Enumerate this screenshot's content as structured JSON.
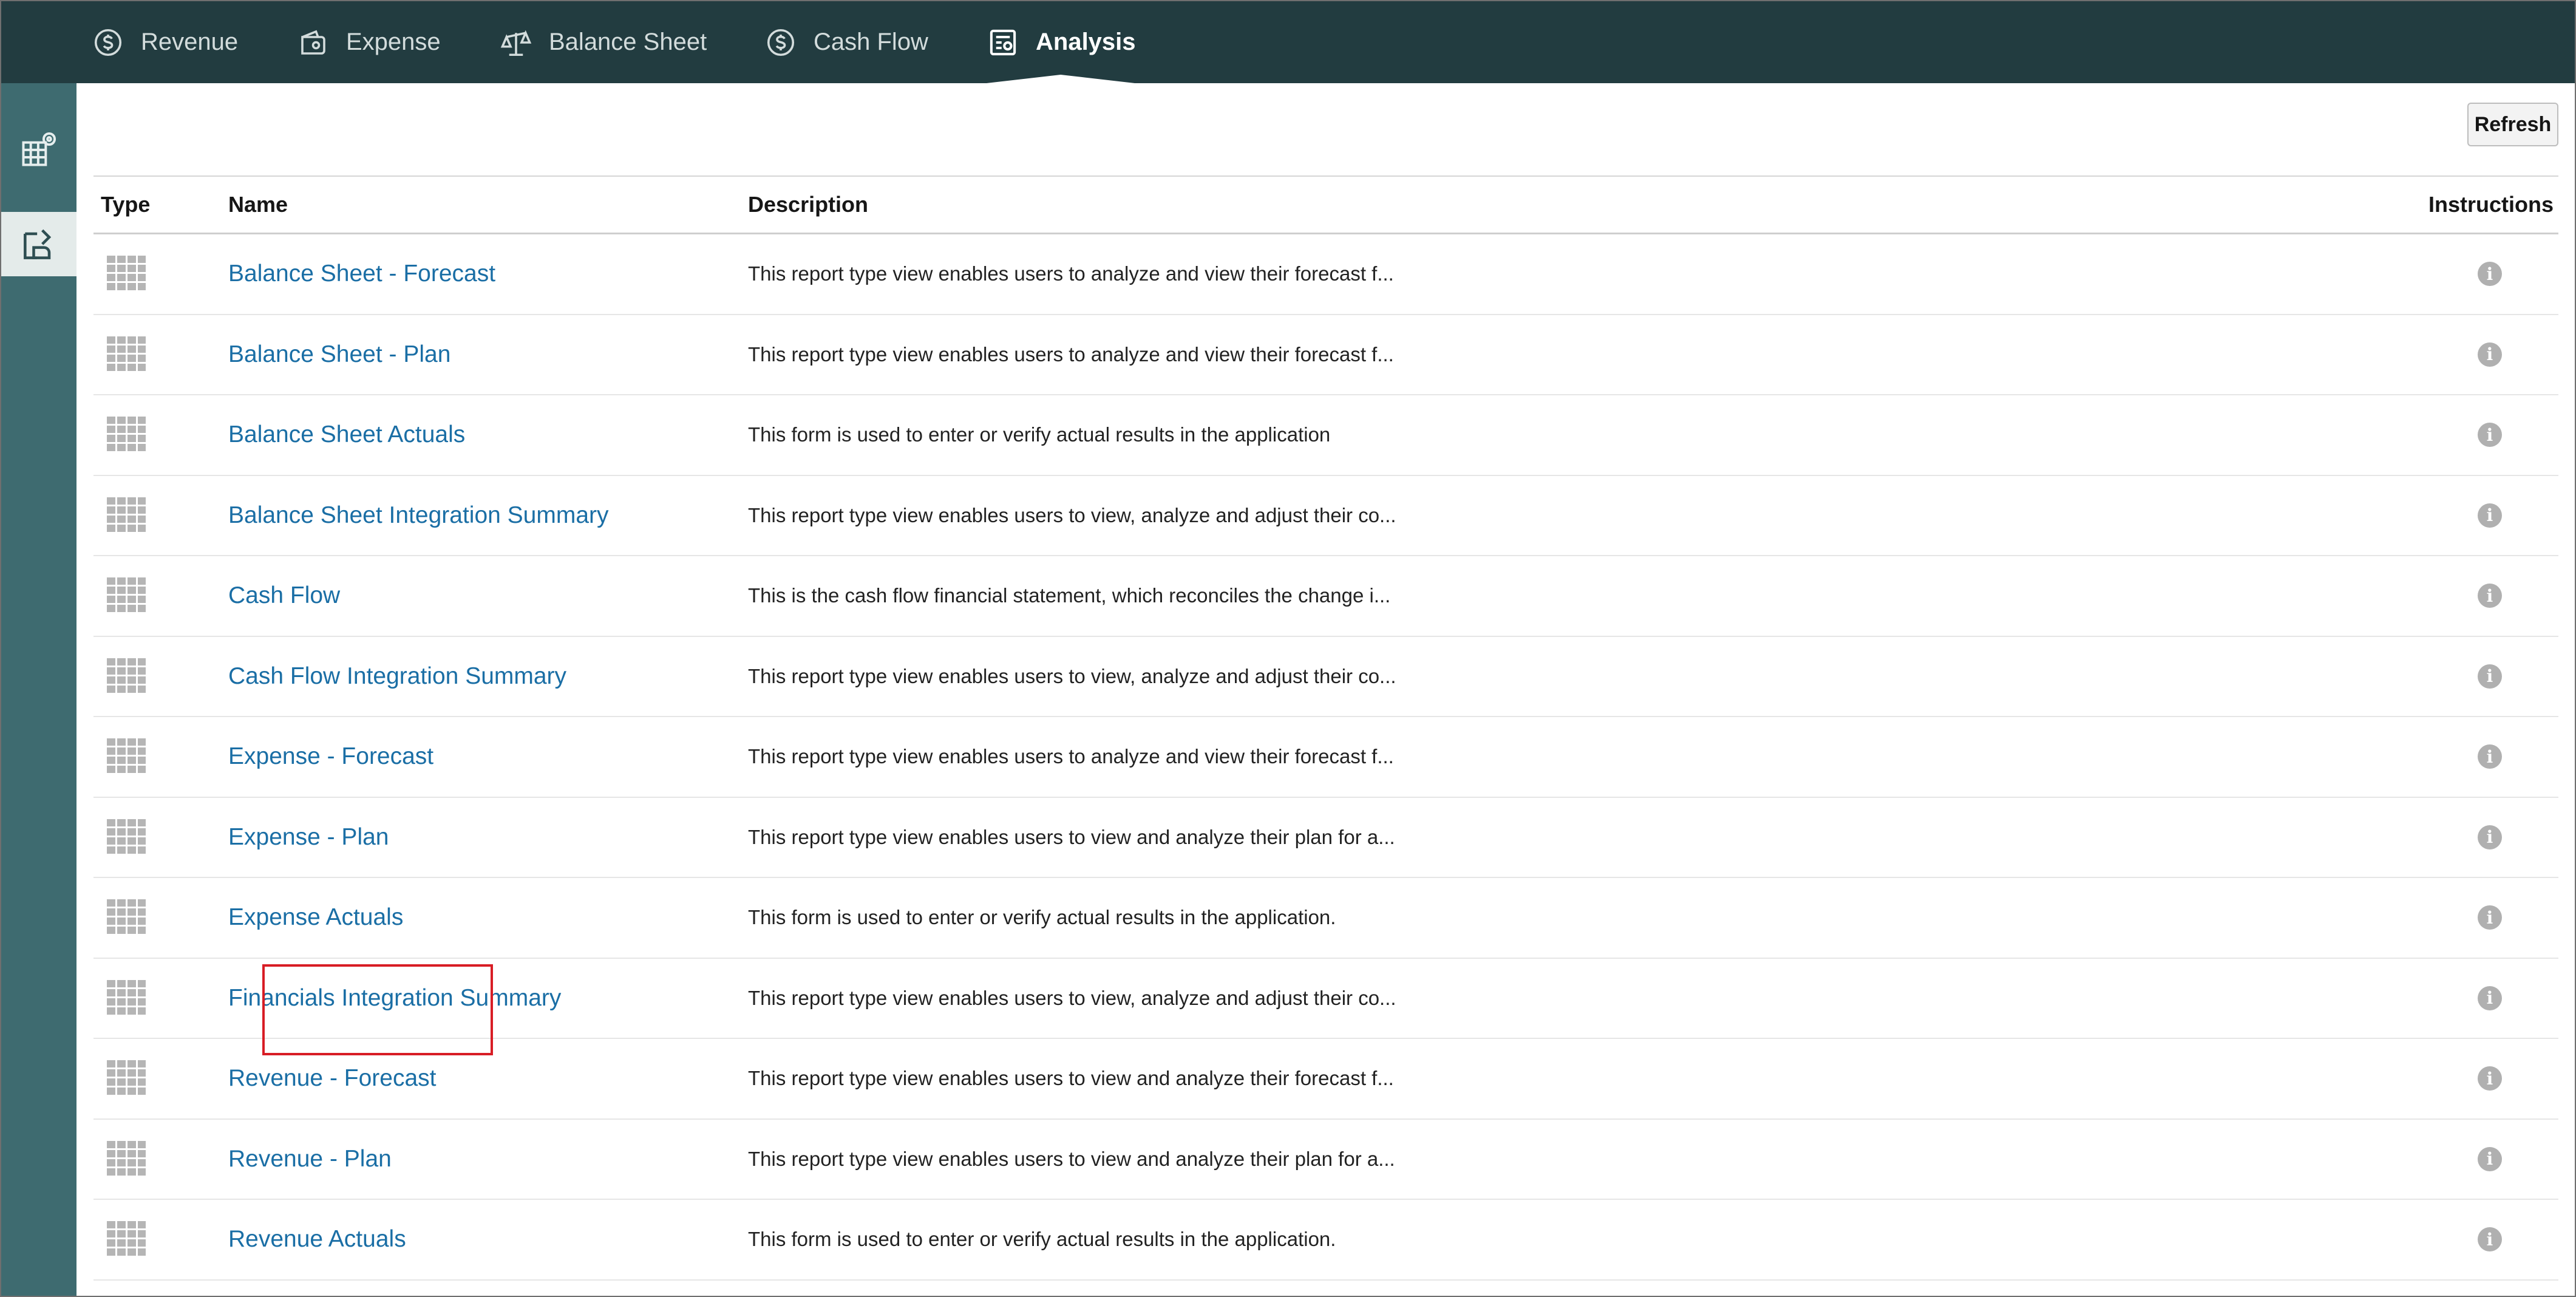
{
  "nav": {
    "tabs": [
      {
        "label": "Revenue",
        "icon": "dollar-circle-icon"
      },
      {
        "label": "Expense",
        "icon": "wallet-icon"
      },
      {
        "label": "Balance Sheet",
        "icon": "scales-icon"
      },
      {
        "label": "Cash Flow",
        "icon": "dollar-circle-icon"
      },
      {
        "label": "Analysis",
        "icon": "report-icon",
        "active": true
      }
    ]
  },
  "sidebar": {
    "items": [
      {
        "icon": "grid-settings-icon"
      },
      {
        "icon": "analysis-forms-icon",
        "active": true
      }
    ]
  },
  "toolbar": {
    "refresh_label": "Refresh"
  },
  "table": {
    "headers": {
      "type": "Type",
      "name": "Name",
      "description": "Description",
      "instructions": "Instructions"
    },
    "rows": [
      {
        "name": "Balance Sheet - Forecast",
        "description": "This report type view enables users to analyze and view their forecast f..."
      },
      {
        "name": "Balance Sheet - Plan",
        "description": "This report type view enables users to analyze and view their forecast f..."
      },
      {
        "name": "Balance Sheet Actuals",
        "description": "This form is used to enter or verify actual results in the application"
      },
      {
        "name": "Balance Sheet Integration Summary",
        "description": "This report type view enables users to view, analyze and adjust their co..."
      },
      {
        "name": "Cash Flow",
        "description": "This is the cash flow financial statement, which reconciles the change i..."
      },
      {
        "name": "Cash Flow Integration Summary",
        "description": "This report type view enables users to view, analyze and adjust their co..."
      },
      {
        "name": "Expense - Forecast",
        "description": "This report type view enables users to analyze and view their forecast f..."
      },
      {
        "name": "Expense - Plan",
        "description": "This report type view enables users to view and analyze their plan for a..."
      },
      {
        "name": "Expense Actuals",
        "description": "This form is used to enter or verify actual results in the application.",
        "highlighted": true
      },
      {
        "name": "Financials Integration Summary",
        "description": "This report type view enables users to view, analyze and adjust their co..."
      },
      {
        "name": "Revenue - Forecast",
        "description": "This report type view enables users to view and analyze their forecast f..."
      },
      {
        "name": "Revenue - Plan",
        "description": "This report type view enables users to view and analyze their plan for a..."
      },
      {
        "name": "Revenue Actuals",
        "description": "This form is used to enter or verify actual results in the application."
      }
    ],
    "info_glyph": "i"
  },
  "colors": {
    "topnav_bg": "#223c40",
    "sidebar_bg": "#3e6b70",
    "link": "#1a6ea5",
    "highlight_border": "#d81d25"
  }
}
